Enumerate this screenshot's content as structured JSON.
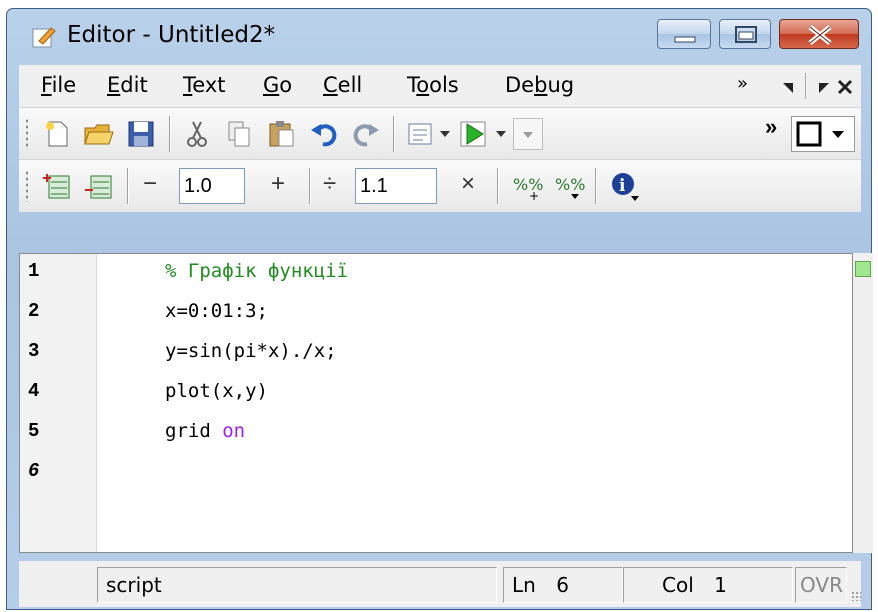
{
  "window": {
    "title": "Editor - Untitled2*"
  },
  "menubar": {
    "items": [
      "File",
      "Edit",
      "Text",
      "Go",
      "Cell",
      "Tools",
      "Debug"
    ],
    "mnemonics": [
      "F",
      "E",
      "T",
      "G",
      "C",
      "o",
      "b"
    ],
    "overflow": "»"
  },
  "toolbar2": {
    "decrement": "−",
    "first_value": "1.0",
    "increment": "+",
    "divide": "÷",
    "second_value": "1.1",
    "multiply": "×"
  },
  "toolbar1": {
    "overflow": "»"
  },
  "editor": {
    "lines": [
      {
        "num": "1",
        "code": "% Графік функції",
        "type": "comment"
      },
      {
        "num": "2",
        "code": "x=0:01:3;",
        "type": "code"
      },
      {
        "num": "3",
        "code": "y=sin(pi*x)./x;",
        "type": "code"
      },
      {
        "num": "4",
        "code": "plot(x,y)",
        "type": "code"
      },
      {
        "num": "5",
        "code": "grid ",
        "keyword": "on",
        "type": "code"
      },
      {
        "num": "6",
        "code": "",
        "type": "code"
      }
    ]
  },
  "statusbar": {
    "mode": "script",
    "ln_label": "Ln",
    "ln_value": "6",
    "col_label": "Col",
    "col_value": "1",
    "ovr": "OVR"
  },
  "colors": {
    "comment": "#228b22",
    "keyword": "#a020f0",
    "title_bar": "#b9d1ea",
    "close_button": "#c0391f"
  },
  "icons": [
    "editor-doc-icon",
    "new-file-icon",
    "open-folder-icon",
    "save-icon",
    "cut-icon",
    "copy-icon",
    "paste-icon",
    "undo-icon",
    "redo-icon",
    "comment-icon",
    "run-icon",
    "dock-box-icon",
    "insert-cell-above-icon",
    "insert-cell-below-icon",
    "increment-percent-icon",
    "decrement-percent-icon",
    "info-icon"
  ]
}
